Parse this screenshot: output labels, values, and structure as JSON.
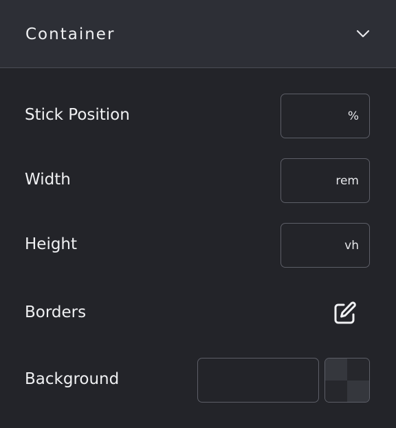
{
  "header": {
    "title": "Container",
    "toggle_icon": "chevron-down-icon"
  },
  "rows": {
    "stick_position": {
      "label": "Stick Position",
      "value": "",
      "unit": "%"
    },
    "width": {
      "label": "Width",
      "value": "",
      "unit": "rem"
    },
    "height": {
      "label": "Height",
      "value": "",
      "unit": "vh"
    },
    "borders": {
      "label": "Borders",
      "icon": "edit-icon"
    },
    "background": {
      "label": "Background",
      "value": "",
      "swatch_icon": "transparent-swatch"
    }
  },
  "colors": {
    "panel_bg": "#232429",
    "header_bg": "#2d2f36",
    "border": "#5d5f68",
    "text": "#f0f1f3"
  }
}
